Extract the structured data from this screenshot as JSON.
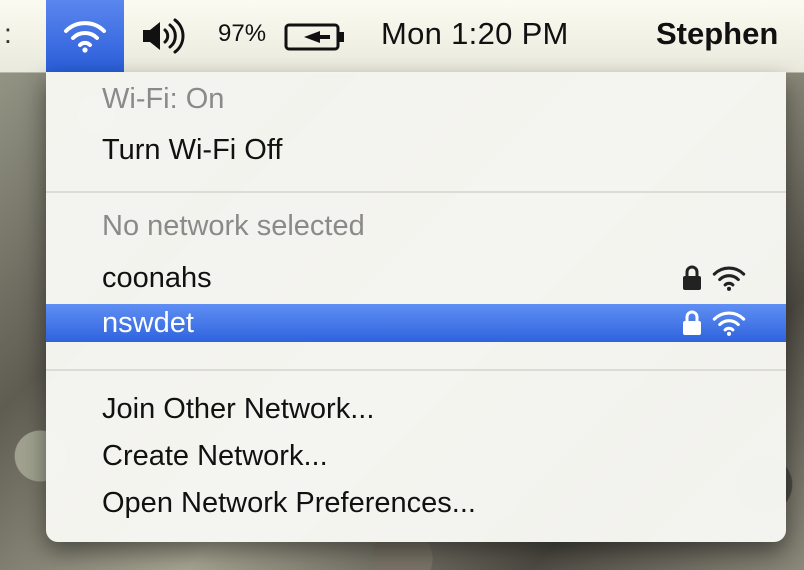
{
  "menubar": {
    "overflow": ":",
    "battery_percent": "97%",
    "clock": "Mon 1:20 PM",
    "user": "Stephen"
  },
  "wifi_menu": {
    "status": "Wi-Fi: On",
    "toggle": "Turn Wi-Fi Off",
    "networks_header": "No network selected",
    "networks": [
      {
        "name": "coonahs",
        "locked": true,
        "highlighted": false
      },
      {
        "name": "nswdet",
        "locked": true,
        "highlighted": true
      }
    ],
    "actions": [
      "Join Other Network...",
      "Create Network...",
      "Open Network Preferences..."
    ]
  },
  "colors": {
    "highlight": "#2f63de",
    "menubar": "#f4f4ea"
  }
}
